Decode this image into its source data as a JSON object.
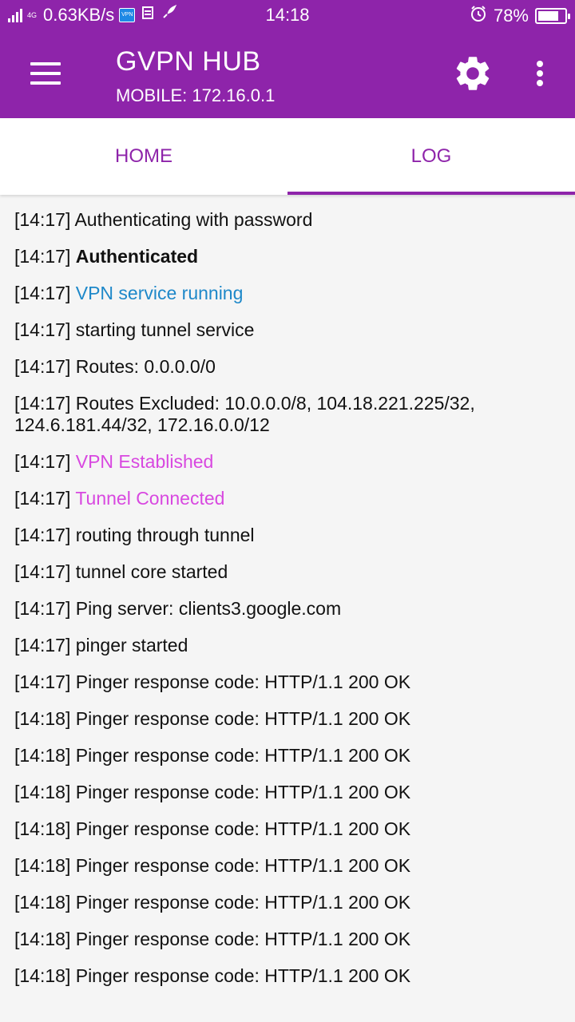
{
  "status_bar": {
    "network_type": "4G",
    "speed": "0.63KB/s",
    "vpn_badge": "VPN",
    "time": "14:18",
    "battery_percent": "78%",
    "battery_level": 0.78
  },
  "app_bar": {
    "title": "GVPN HUB",
    "subtitle": "MOBILE: 172.16.0.1",
    "color": "#8e24aa"
  },
  "tabs": [
    {
      "label": "HOME",
      "selected": false
    },
    {
      "label": "LOG",
      "selected": true
    }
  ],
  "log": [
    {
      "time": "[14:17]",
      "message": "Authenticating with password",
      "style": "normal"
    },
    {
      "time": "[14:17]",
      "message": "Authenticated",
      "style": "bold"
    },
    {
      "time": "[14:17]",
      "message": "VPN service running",
      "style": "blue"
    },
    {
      "time": "[14:17]",
      "message": "starting tunnel service",
      "style": "normal"
    },
    {
      "time": "[14:17]",
      "message": "Routes: 0.0.0.0/0",
      "style": "normal"
    },
    {
      "time": "[14:17]",
      "message": "Routes Excluded: 10.0.0.0/8, 104.18.221.225/32, 124.6.181.44/32, 172.16.0.0/12",
      "style": "normal"
    },
    {
      "time": "[14:17]",
      "message": "VPN Established",
      "style": "pink"
    },
    {
      "time": "[14:17]",
      "message": "Tunnel Connected",
      "style": "pink"
    },
    {
      "time": "[14:17]",
      "message": "routing through tunnel",
      "style": "normal"
    },
    {
      "time": "[14:17]",
      "message": "tunnel core started",
      "style": "normal"
    },
    {
      "time": "[14:17]",
      "message": "Ping server: clients3.google.com",
      "style": "normal"
    },
    {
      "time": "[14:17]",
      "message": "pinger started",
      "style": "normal"
    },
    {
      "time": "[14:17]",
      "message": "Pinger response code: HTTP/1.1 200 OK",
      "style": "normal"
    },
    {
      "time": "[14:18]",
      "message": "Pinger response code: HTTP/1.1 200 OK",
      "style": "normal"
    },
    {
      "time": "[14:18]",
      "message": "Pinger response code: HTTP/1.1 200 OK",
      "style": "normal"
    },
    {
      "time": "[14:18]",
      "message": "Pinger response code: HTTP/1.1 200 OK",
      "style": "normal"
    },
    {
      "time": "[14:18]",
      "message": "Pinger response code: HTTP/1.1 200 OK",
      "style": "normal"
    },
    {
      "time": "[14:18]",
      "message": "Pinger response code: HTTP/1.1 200 OK",
      "style": "normal"
    },
    {
      "time": "[14:18]",
      "message": "Pinger response code: HTTP/1.1 200 OK",
      "style": "normal"
    },
    {
      "time": "[14:18]",
      "message": "Pinger response code: HTTP/1.1 200 OK",
      "style": "normal"
    },
    {
      "time": "[14:18]",
      "message": "Pinger response code: HTTP/1.1 200 OK",
      "style": "normal"
    }
  ],
  "colors": {
    "accent": "#8e24aa",
    "log_blue": "#1e88c9",
    "log_pink": "#d848e0"
  },
  "icons": {
    "menu": "hamburger-menu-icon",
    "settings": "gear-icon",
    "more": "more-vert-icon",
    "alarm": "alarm-clock-icon",
    "rocket": "rocket-icon"
  }
}
